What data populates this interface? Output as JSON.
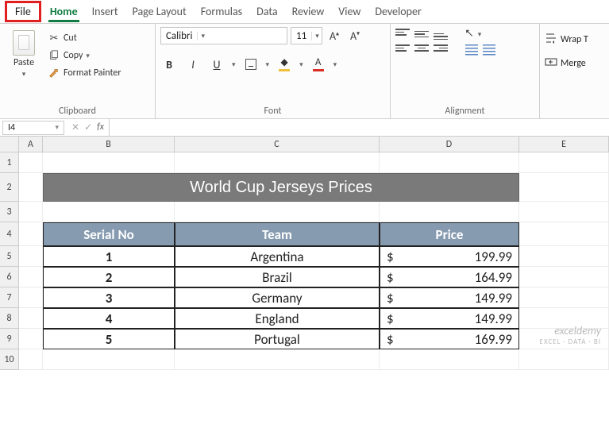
{
  "tabs": {
    "file": "File",
    "home": "Home",
    "insert": "Insert",
    "page_layout": "Page Layout",
    "formulas": "Formulas",
    "data": "Data",
    "review": "Review",
    "view": "View",
    "developer": "Developer"
  },
  "ribbon": {
    "clipboard": {
      "label": "Clipboard",
      "paste": "Paste",
      "cut": "Cut",
      "copy": "Copy",
      "painter": "Format Painter"
    },
    "font": {
      "label": "Font",
      "name": "Calibri",
      "size": "11",
      "bold": "B",
      "italic": "I",
      "underline": "U"
    },
    "alignment": {
      "label": "Alignment"
    },
    "wrap": {
      "wrap": "Wrap T",
      "merge": "Merge "
    }
  },
  "formula_bar": {
    "name_box": "I4",
    "formula": ""
  },
  "columns": [
    "A",
    "B",
    "C",
    "D",
    "E"
  ],
  "rownums": [
    "1",
    "2",
    "3",
    "4",
    "5",
    "6",
    "7",
    "8",
    "9",
    "10"
  ],
  "sheet": {
    "title": "World Cup Jerseys Prices",
    "hdr_serial": "Serial No",
    "hdr_team": "Team",
    "hdr_price": "Price",
    "cur": "$",
    "rows": [
      {
        "n": "1",
        "team": "Argentina",
        "price": "199.99"
      },
      {
        "n": "2",
        "team": "Brazil",
        "price": "164.99"
      },
      {
        "n": "3",
        "team": "Germany",
        "price": "149.99"
      },
      {
        "n": "4",
        "team": "England",
        "price": "149.99"
      },
      {
        "n": "5",
        "team": "Portugal",
        "price": "169.99"
      }
    ]
  },
  "watermark": {
    "main": "exceldemy",
    "sub": "EXCEL · DATA · BI"
  }
}
